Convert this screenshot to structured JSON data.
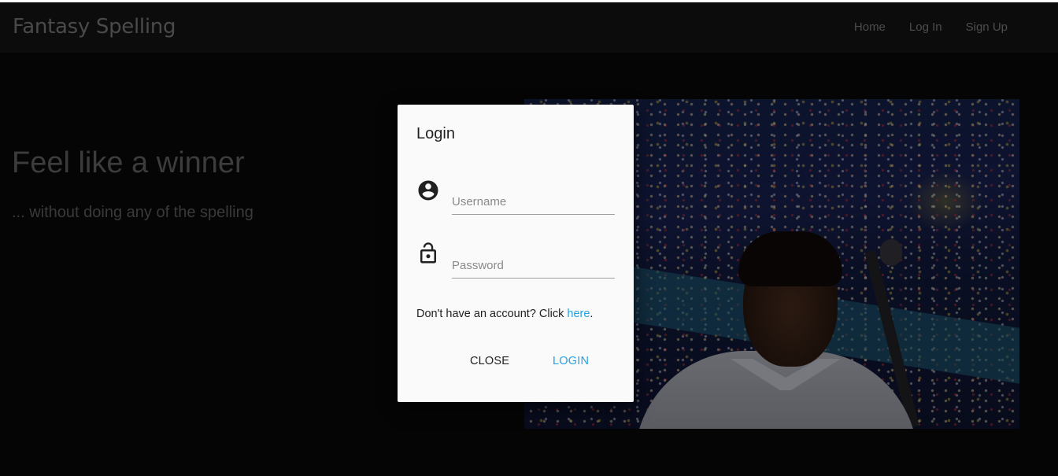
{
  "navbar": {
    "brand": "Fantasy Spelling",
    "links": [
      "Home",
      "Log In",
      "Sign Up"
    ]
  },
  "hero": {
    "title": "Feel like a winner",
    "subtitle": "... without doing any of the spelling"
  },
  "modal": {
    "title": "Login",
    "username_placeholder": "Username",
    "username_value": "",
    "password_placeholder": "Password",
    "password_value": "",
    "signup_prompt": "Don't have an account? Click ",
    "signup_link": "here",
    "signup_suffix": ".",
    "close_label": "CLOSE",
    "login_label": "LOGIN",
    "icons": [
      "account-circle-icon",
      "lock-icon"
    ]
  },
  "colors": {
    "accent": "#26a1e0",
    "page_background": "#050505",
    "navbar_background": "#0c0c0c",
    "modal_background": "#fafafa"
  }
}
